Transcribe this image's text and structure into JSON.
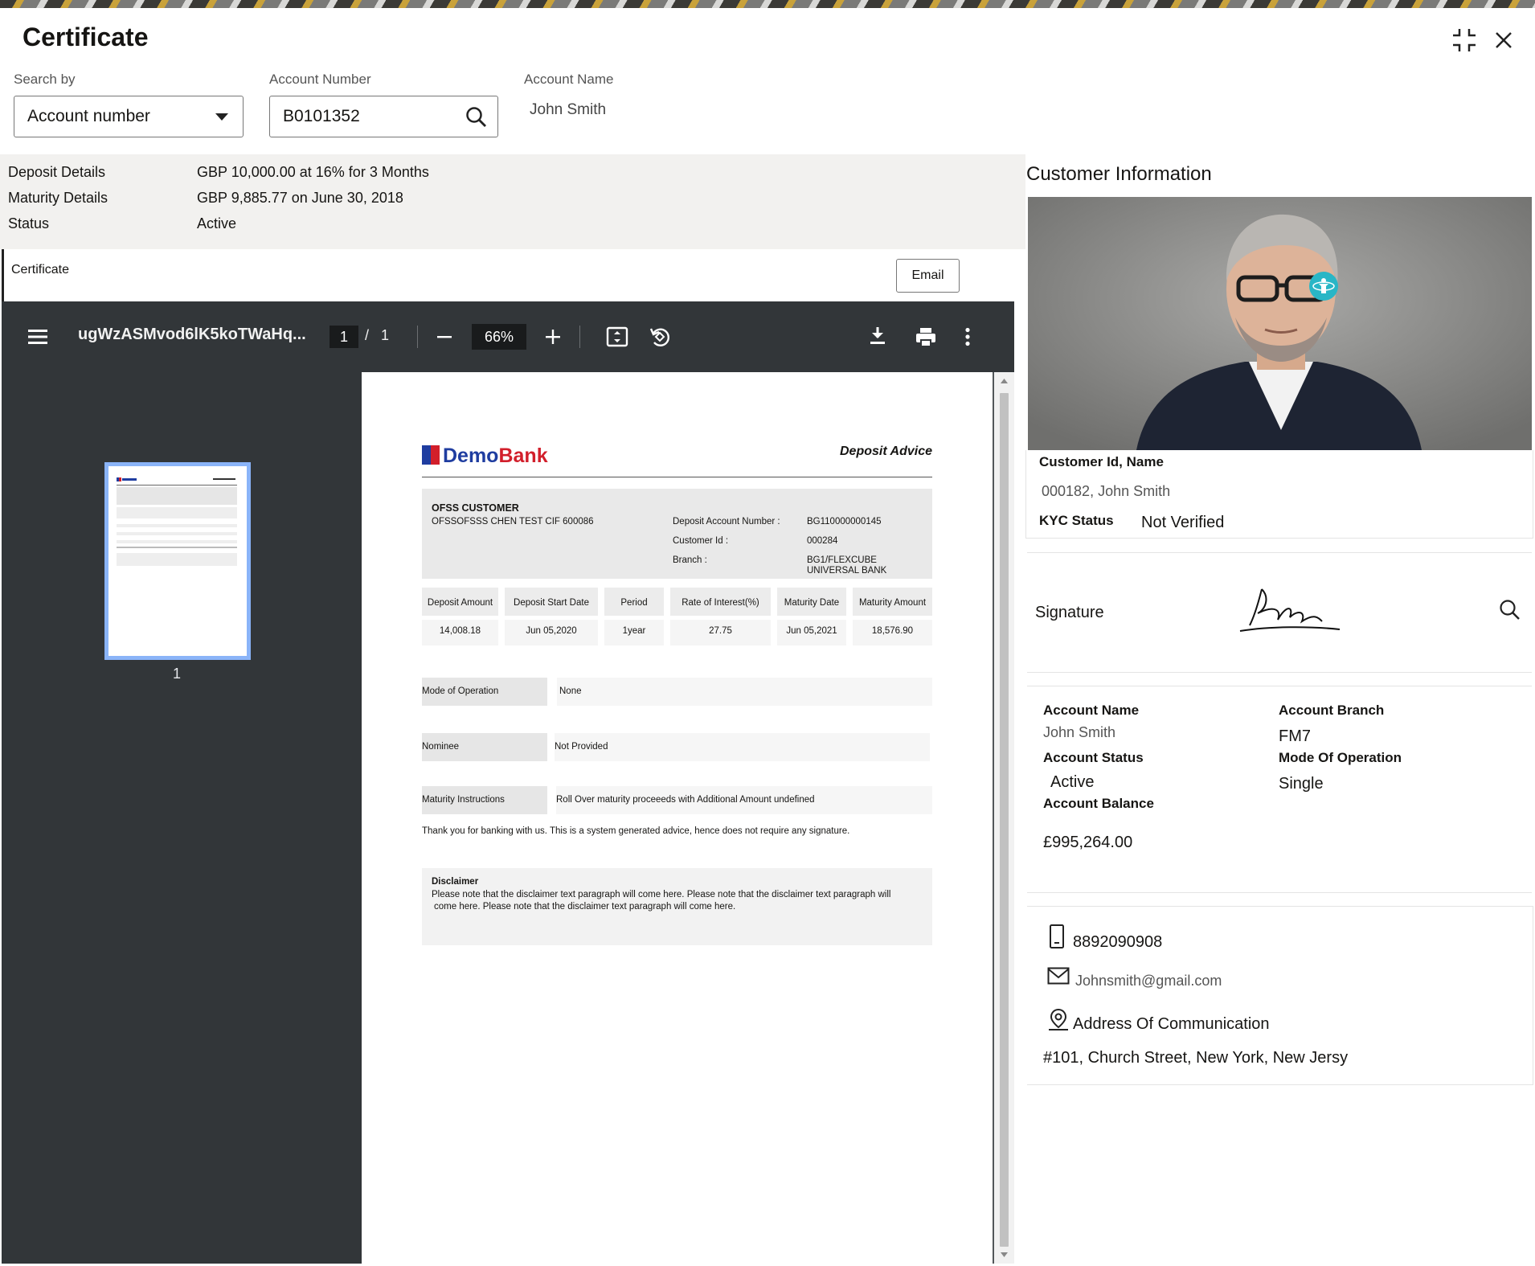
{
  "window": {
    "title": "Certificate"
  },
  "search": {
    "search_by_label": "Search by",
    "search_by_value": "Account number",
    "account_number_label": "Account Number",
    "account_number_value": "B0101352",
    "account_name_label": "Account Name",
    "account_name_value": "John Smith"
  },
  "details": {
    "rows": [
      {
        "label": "Deposit Details",
        "value": "GBP 10,000.00 at 16% for 3 Months"
      },
      {
        "label": "Maturity Details",
        "value": "GBP 9,885.77 on June 30, 2018"
      },
      {
        "label": "Status",
        "value": "Active"
      }
    ]
  },
  "certificate": {
    "label": "Certificate",
    "email_button": "Email"
  },
  "pdf_viewer": {
    "file_name": "ugWzASMvod6lK5koTWaHq...",
    "current_page": "1",
    "separator": "/",
    "total_pages": "1",
    "zoom": "66%",
    "thumbnail_page": "1"
  },
  "document": {
    "bank_name_part1": "Demo",
    "bank_name_part2": "Bank",
    "doc_title": "Deposit Advice",
    "customer_heading": "OFSS CUSTOMER",
    "customer_line": "OFSSOFSSS CHEN TEST CIF 600086",
    "deposit_account_label": "Deposit Account Number :",
    "deposit_account_value": "BG110000000145",
    "customer_id_label": "Customer Id :",
    "customer_id_value": "000284",
    "branch_label": "Branch :",
    "branch_value_1": "BG1/FLEXCUBE",
    "branch_value_2": "UNIVERSAL BANK",
    "table_headers": [
      "Deposit Amount",
      "Deposit Start Date",
      "Period",
      "Rate of Interest(%)",
      "Maturity Date",
      "Maturity Amount"
    ],
    "table_values": [
      "14,008.18",
      "Jun 05,2020",
      "1year",
      "27.75",
      "Jun 05,2021",
      "18,576.90"
    ],
    "mode_label": "Mode of Operation",
    "mode_value": "None",
    "nominee_label": "Nominee",
    "nominee_value": "Not Provided",
    "maturity_instr_label": "Maturity Instructions",
    "maturity_instr_value": "Roll Over maturity proceeeds with Additional Amount undefined",
    "thank_you": "Thank you for banking with us. This is a system generated advice, hence does not require any signature.",
    "disclaimer_title": "Disclaimer",
    "disclaimer_line1": "Please note that the disclaimer text paragraph will come here. Please note that the disclaimer text paragraph will",
    "disclaimer_line2": "come here. Please note that the disclaimer text paragraph will come here."
  },
  "customer_info": {
    "title": "Customer Information",
    "id_name_label": "Customer Id, Name",
    "id_name_value": "000182, John Smith",
    "kyc_label": "KYC Status",
    "kyc_value": "Not Verified",
    "signature_label": "Signature",
    "account_name_label": "Account Name",
    "account_name_value": "John Smith",
    "account_branch_label": "Account Branch",
    "account_branch_value": "FM7",
    "account_status_label": "Account Status",
    "account_status_value": "Active",
    "mode_label": "Mode Of Operation",
    "mode_value": "Single",
    "balance_label": "Account Balance",
    "balance_value": "£995,264.00",
    "phone": "8892090908",
    "email": "Johnsmith@gmail.com",
    "address_label": "Address Of Communication",
    "address_value": "#101, Church Street, New York, New Jersy"
  },
  "colors": {
    "viewer_bg": "#525659",
    "toolbar_bg": "#323639",
    "thumb_border": "#8ab4f8",
    "brand_blue": "#1f3da0",
    "brand_red": "#d21f2b",
    "accent_teal": "#29b6c6"
  }
}
